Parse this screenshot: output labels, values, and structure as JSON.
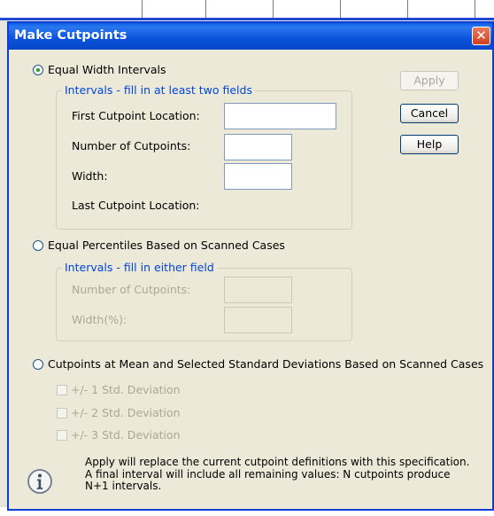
{
  "dialog": {
    "title": "Make Cutpoints",
    "close_glyph": "✕"
  },
  "equal_width": {
    "radio_label": "Equal Width Intervals",
    "selected": true,
    "group_label": "Intervals - fill in at least two fields",
    "fields": {
      "first_cutpoint_label": "First Cutpoint Location:",
      "first_cutpoint_value": "",
      "num_cutpoints_label": "Number of Cutpoints:",
      "num_cutpoints_value": "",
      "width_label": "Width:",
      "width_value": "",
      "last_cutpoint_label": "Last Cutpoint Location:"
    }
  },
  "equal_percentiles": {
    "radio_label": "Equal Percentiles Based on Scanned Cases",
    "selected": false,
    "group_label": "Intervals - fill in either field",
    "fields": {
      "num_cutpoints_label": "Number of Cutpoints:",
      "num_cutpoints_value": "",
      "width_label": "Width(%):",
      "width_value": ""
    }
  },
  "mean_sd": {
    "radio_label": "Cutpoints at Mean and Selected Standard Deviations Based on Scanned Cases",
    "selected": false,
    "checkboxes": [
      {
        "label": "+/- 1 Std. Deviation",
        "checked": false
      },
      {
        "label": "+/- 2 Std. Deviation",
        "checked": false
      },
      {
        "label": "+/- 3 Std. Deviation",
        "checked": false
      }
    ]
  },
  "buttons": {
    "apply": "Apply",
    "cancel": "Cancel",
    "help": "Help"
  },
  "info": {
    "icon": "info-icon",
    "text": "Apply will replace the current cutpoint definitions with this specification. A final interval will include all remaining values: N cutpoints produce N+1 intervals."
  },
  "colors": {
    "title_bar": "#0a52db",
    "group_label": "#0046d5",
    "disabled_text": "#aca899",
    "dialog_bg": "#ece9d8"
  }
}
